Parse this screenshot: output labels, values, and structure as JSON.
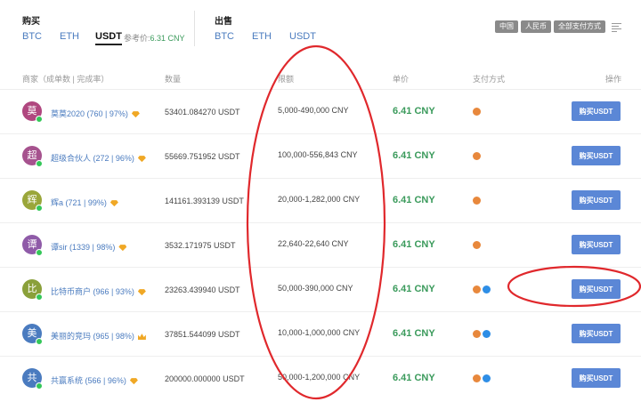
{
  "buy_section": {
    "label": "购买",
    "coins": [
      "BTC",
      "ETH",
      "USDT"
    ],
    "active_coin": "USDT"
  },
  "reference_price": {
    "label": "参考价:",
    "value": "6.31 CNY"
  },
  "sell_section": {
    "label": "出售",
    "coins": [
      "BTC",
      "ETH",
      "USDT"
    ]
  },
  "filters": {
    "chips": [
      "中国",
      "人民币",
      "全部支付方式"
    ],
    "icon": "filter-list-icon"
  },
  "table": {
    "headers": {
      "merchant": "商家（成单数 | 完成率）",
      "quantity": "数量",
      "limit": "限额",
      "price": "单价",
      "payment": "支付方式",
      "action": "操作"
    },
    "rows": [
      {
        "avatar_char": "莫",
        "avatar_color": "#b0477f",
        "merchant": "莫莫2020 (760 | 97%)",
        "badge": "diamond",
        "quantity": "53401.084270 USDT",
        "limit": "5,000-490,000 CNY",
        "price": "6.41 CNY",
        "payments": [
          "bank"
        ],
        "button": "购买USDT"
      },
      {
        "avatar_char": "超",
        "avatar_color": "#a6528e",
        "merchant": "超级合伙人 (272 | 96%)",
        "badge": "diamond",
        "quantity": "55669.751952 USDT",
        "limit": "100,000-556,843 CNY",
        "price": "6.41 CNY",
        "payments": [
          "bank"
        ],
        "button": "购买USDT"
      },
      {
        "avatar_char": "辉",
        "avatar_color": "#9aa63a",
        "merchant": "辉a (721 | 99%)",
        "badge": "diamond",
        "quantity": "141161.393139 USDT",
        "limit": "20,000-1,282,000 CNY",
        "price": "6.41 CNY",
        "payments": [
          "bank"
        ],
        "button": "购买USDT"
      },
      {
        "avatar_char": "谭",
        "avatar_color": "#8f5ba8",
        "merchant": "谭sir (1339 | 98%)",
        "badge": "diamond",
        "quantity": "3532.171975 USDT",
        "limit": "22,640-22,640 CNY",
        "price": "6.41 CNY",
        "payments": [
          "bank"
        ],
        "button": "购买USDT"
      },
      {
        "avatar_char": "比",
        "avatar_color": "#8aa03a",
        "merchant": "比特币商户 (966 | 93%)",
        "badge": "diamond",
        "quantity": "23263.439940 USDT",
        "limit": "50,000-390,000 CNY",
        "price": "6.41 CNY",
        "payments": [
          "bank",
          "alipay"
        ],
        "button": "购买USDT"
      },
      {
        "avatar_char": "美",
        "avatar_color": "#4a7bbf",
        "merchant": "美丽的竞玛 (965 | 98%)",
        "badge": "crown",
        "quantity": "37851.544099 USDT",
        "limit": "10,000-1,000,000 CNY",
        "price": "6.41 CNY",
        "payments": [
          "bank",
          "alipay"
        ],
        "button": "购买USDT"
      },
      {
        "avatar_char": "共",
        "avatar_color": "#4a7bbf",
        "merchant": "共赢系统 (566 | 96%)",
        "badge": "diamond",
        "quantity": "200000.000000 USDT",
        "limit": "50,000-1,200,000 CNY",
        "price": "6.41 CNY",
        "payments": [
          "bank",
          "alipay"
        ],
        "button": "购买USDT"
      }
    ]
  },
  "annotation_color": "#e0282c"
}
